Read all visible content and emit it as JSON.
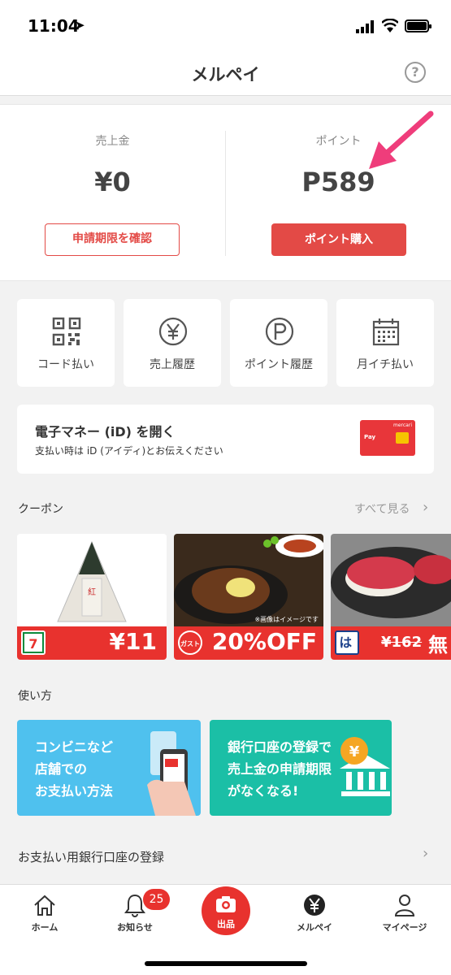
{
  "status_bar": {
    "time": "11:04"
  },
  "nav": {
    "title": "メルペイ",
    "help_label": "?"
  },
  "balance": {
    "sales_label": "売上金",
    "sales_value": "¥0",
    "sales_button": "申請期限を確認",
    "points_label": "ポイント",
    "points_value": "P589",
    "points_button": "ポイント購入"
  },
  "tiles": [
    {
      "label": "コード払い",
      "icon": "qr-code-icon"
    },
    {
      "label": "売上履歴",
      "icon": "yen-circle-icon"
    },
    {
      "label": "ポイント履歴",
      "icon": "p-circle-icon"
    },
    {
      "label": "月イチ払い",
      "icon": "calendar-icon"
    }
  ],
  "emoney": {
    "title": "電子マネー (iD) を開く",
    "subtitle": "支払い時は iD (アイディ)とお伝えください",
    "card_brand": "mercari",
    "card_pay": "Pay"
  },
  "coupons": {
    "section_title": "クーポン",
    "see_all": "すべて見る",
    "items": [
      {
        "price": "¥11"
      },
      {
        "price": "20%OFF",
        "logo_text": "ガスト",
        "note": "※画像はイメージです"
      },
      {
        "price": "¥162",
        "extra": "無"
      }
    ]
  },
  "howto": {
    "section_title": "使い方",
    "cards": [
      {
        "line1": "コンビニなど",
        "line2": "店舗での",
        "line3": "お支払い方法",
        "color": "#4fc1ee"
      },
      {
        "line1": "銀行口座の登録で",
        "line2": "売上金の申請期限",
        "line3": "がなくなる!",
        "color": "#1bbfa6"
      }
    ]
  },
  "bank": {
    "label": "お支払い用銀行口座の登録"
  },
  "tabbar": {
    "home": "ホーム",
    "notifications": "お知らせ",
    "notifications_badge": "25",
    "sell": "出品",
    "merpay": "メルペイ",
    "mypage": "マイページ"
  },
  "colors": {
    "accent": "#e34a46",
    "arrow": "#ef3d7b"
  }
}
